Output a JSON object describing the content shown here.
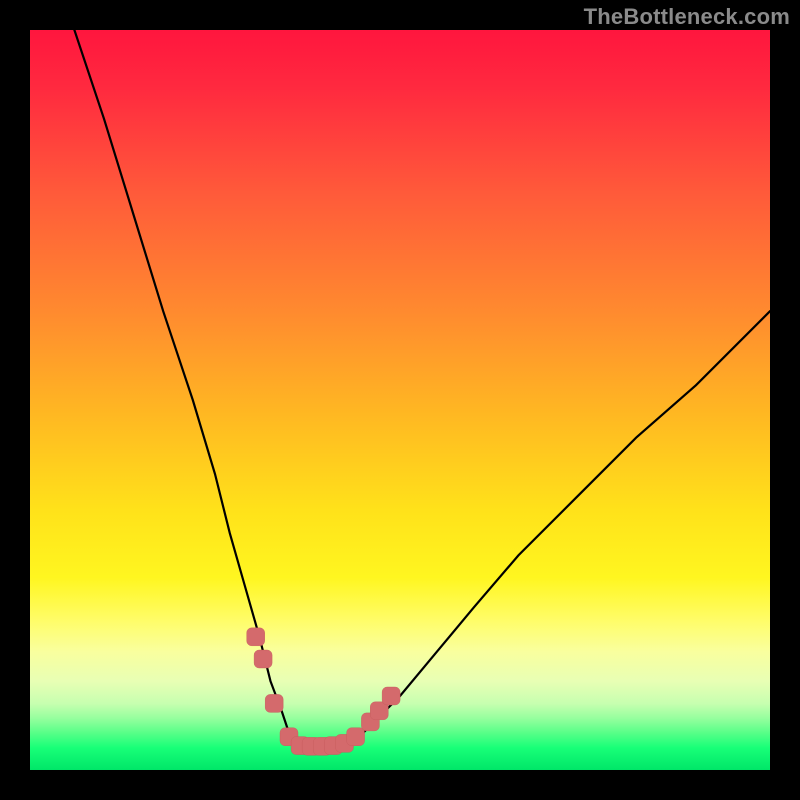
{
  "watermark": "TheBottleneck.com",
  "colors": {
    "background": "#000000",
    "watermark": "#8a8a8a",
    "curve": "#000000",
    "marker": "#d46a6c"
  },
  "chart_data": {
    "type": "line",
    "title": "",
    "xlabel": "",
    "ylabel": "",
    "xlim": [
      0,
      100
    ],
    "ylim": [
      0,
      100
    ],
    "grid": false,
    "series": [
      {
        "name": "bottleneck-curve",
        "x": [
          6,
          10,
          14,
          18,
          22,
          25,
          27,
          29,
          31,
          32.5,
          34,
          35,
          36.5,
          38,
          40,
          42,
          45,
          50,
          55,
          60,
          66,
          74,
          82,
          90,
          100
        ],
        "values": [
          100,
          88,
          75,
          62,
          50,
          40,
          32,
          25,
          18,
          12,
          8,
          5,
          3.5,
          3.2,
          3.2,
          3.5,
          5,
          10,
          16,
          22,
          29,
          37,
          45,
          52,
          62
        ]
      }
    ],
    "markers": {
      "name": "guide-points",
      "points": [
        {
          "x": 30.5,
          "y": 18
        },
        {
          "x": 31.5,
          "y": 15
        },
        {
          "x": 33.0,
          "y": 9
        },
        {
          "x": 35.0,
          "y": 4.5
        },
        {
          "x": 36.5,
          "y": 3.3
        },
        {
          "x": 38.0,
          "y": 3.2
        },
        {
          "x": 39.5,
          "y": 3.2
        },
        {
          "x": 41.0,
          "y": 3.3
        },
        {
          "x": 42.5,
          "y": 3.6
        },
        {
          "x": 44.0,
          "y": 4.5
        },
        {
          "x": 46.0,
          "y": 6.5
        },
        {
          "x": 47.2,
          "y": 8.0
        },
        {
          "x": 48.8,
          "y": 10.0
        }
      ],
      "radius": 9
    }
  }
}
